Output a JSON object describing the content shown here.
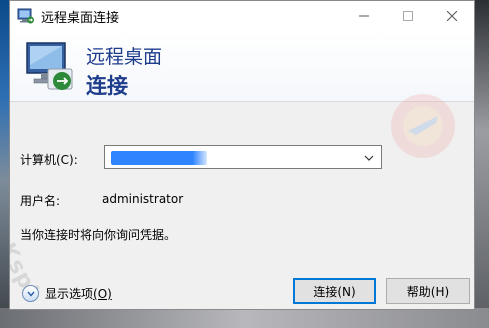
{
  "window": {
    "title": "远程桌面连接"
  },
  "header": {
    "title_line1": "远程桌面",
    "title_line2": "连接"
  },
  "form": {
    "computer_label": "计算机(C):",
    "computer_value": "",
    "username_label": "用户名:",
    "username_value": "administrator",
    "credentials_note": "当你连接时将向你询问凭据。"
  },
  "footer": {
    "show_options_label": "显示选项",
    "show_options_hotkey": "(O)",
    "connect_button": "连接(N)",
    "help_button": "帮助(H)"
  },
  "icons": {
    "app": "remote-desktop-icon",
    "minimize": "minimize-icon",
    "maximize": "maximize-icon",
    "close": "close-icon",
    "dropdown": "chevron-down-icon",
    "options": "expand-down-icon"
  },
  "colors": {
    "header_title": "#1e3c8c",
    "accent": "#0078d7",
    "redaction": "#2f84ff"
  }
}
